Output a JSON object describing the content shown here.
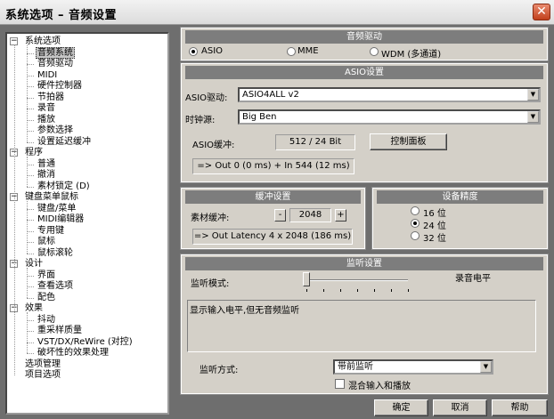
{
  "window": {
    "title": "系统选项 – 音频设置",
    "close_glyph": "✕"
  },
  "tree": {
    "items": [
      {
        "label": "系统选项",
        "level": 0,
        "expander": "−"
      },
      {
        "label": "音频系统",
        "level": 1,
        "selected": true
      },
      {
        "label": "音频驱动",
        "level": 1
      },
      {
        "label": "MIDI",
        "level": 1
      },
      {
        "label": "硬件控制器",
        "level": 1
      },
      {
        "label": "节拍器",
        "level": 1
      },
      {
        "label": "录音",
        "level": 1
      },
      {
        "label": "播放",
        "level": 1
      },
      {
        "label": "参数选择",
        "level": 1
      },
      {
        "label": "设置延迟缓冲",
        "level": 1
      },
      {
        "label": "程序",
        "level": 0,
        "expander": "−"
      },
      {
        "label": "普通",
        "level": 1
      },
      {
        "label": "撤消",
        "level": 1
      },
      {
        "label": "素材锁定 (D)",
        "level": 1
      },
      {
        "label": "键盘菜单鼠标",
        "level": 0,
        "expander": "−"
      },
      {
        "label": "键盘/菜单",
        "level": 1
      },
      {
        "label": "MIDI编辑器",
        "level": 1
      },
      {
        "label": "专用键",
        "level": 1
      },
      {
        "label": "鼠标",
        "level": 1
      },
      {
        "label": "鼠标滚轮",
        "level": 1
      },
      {
        "label": "设计",
        "level": 0,
        "expander": "−"
      },
      {
        "label": "界面",
        "level": 1
      },
      {
        "label": "查看选项",
        "level": 1
      },
      {
        "label": "配色",
        "level": 1
      },
      {
        "label": "效果",
        "level": 0,
        "expander": "−"
      },
      {
        "label": "抖动",
        "level": 1
      },
      {
        "label": "重采样质量",
        "level": 1
      },
      {
        "label": "VST/DX/ReWire (对控)",
        "level": 1
      },
      {
        "label": "破坏性的效果处理",
        "level": 1
      },
      {
        "label": "选项管理",
        "level": 0
      },
      {
        "label": "项目选项",
        "level": 0
      }
    ]
  },
  "audio_driver": {
    "title": "音频驱动",
    "options": [
      {
        "label": "ASIO",
        "selected": true
      },
      {
        "label": "MME",
        "selected": false
      },
      {
        "label": "WDM (多通道)",
        "selected": false
      }
    ]
  },
  "asio": {
    "title": "ASIO设置",
    "driver_label": "ASIO驱动:",
    "driver_value": "ASIO4ALL v2",
    "clock_label": "时钟源:",
    "clock_value": "Big Ben",
    "buffer_label": "ASIO缓冲:",
    "buffer_value": "512 / 24 Bit",
    "control_panel_button": "控制面板",
    "latency": "=> Out 0 (0 ms) + In 544 (12 ms)"
  },
  "buffer": {
    "title": "缓冲设置",
    "material_label": "素材缓冲:",
    "minus": "-",
    "value": "2048",
    "plus": "+",
    "latency": "=> Out Latency 4 x 2048 (186 ms)"
  },
  "precision": {
    "title": "设备精度",
    "options": [
      {
        "label": "16 位",
        "selected": false
      },
      {
        "label": "24 位",
        "selected": true
      },
      {
        "label": "32 位",
        "selected": false
      }
    ]
  },
  "monitor": {
    "title": "监听设置",
    "mode_label": "监听模式:",
    "level_label": "录音电平",
    "mode_level": 0.0,
    "description": "显示输入电平,但无音频监听",
    "method_label": "监听方式:",
    "method_value": "带前监听",
    "mix_label": "混合输入和播放",
    "mix_checked": false
  },
  "footer": {
    "ok": "确定",
    "cancel": "取消",
    "help": "帮助"
  },
  "icons": {
    "dropdown": "chevron-down-icon",
    "close": "close-icon"
  }
}
